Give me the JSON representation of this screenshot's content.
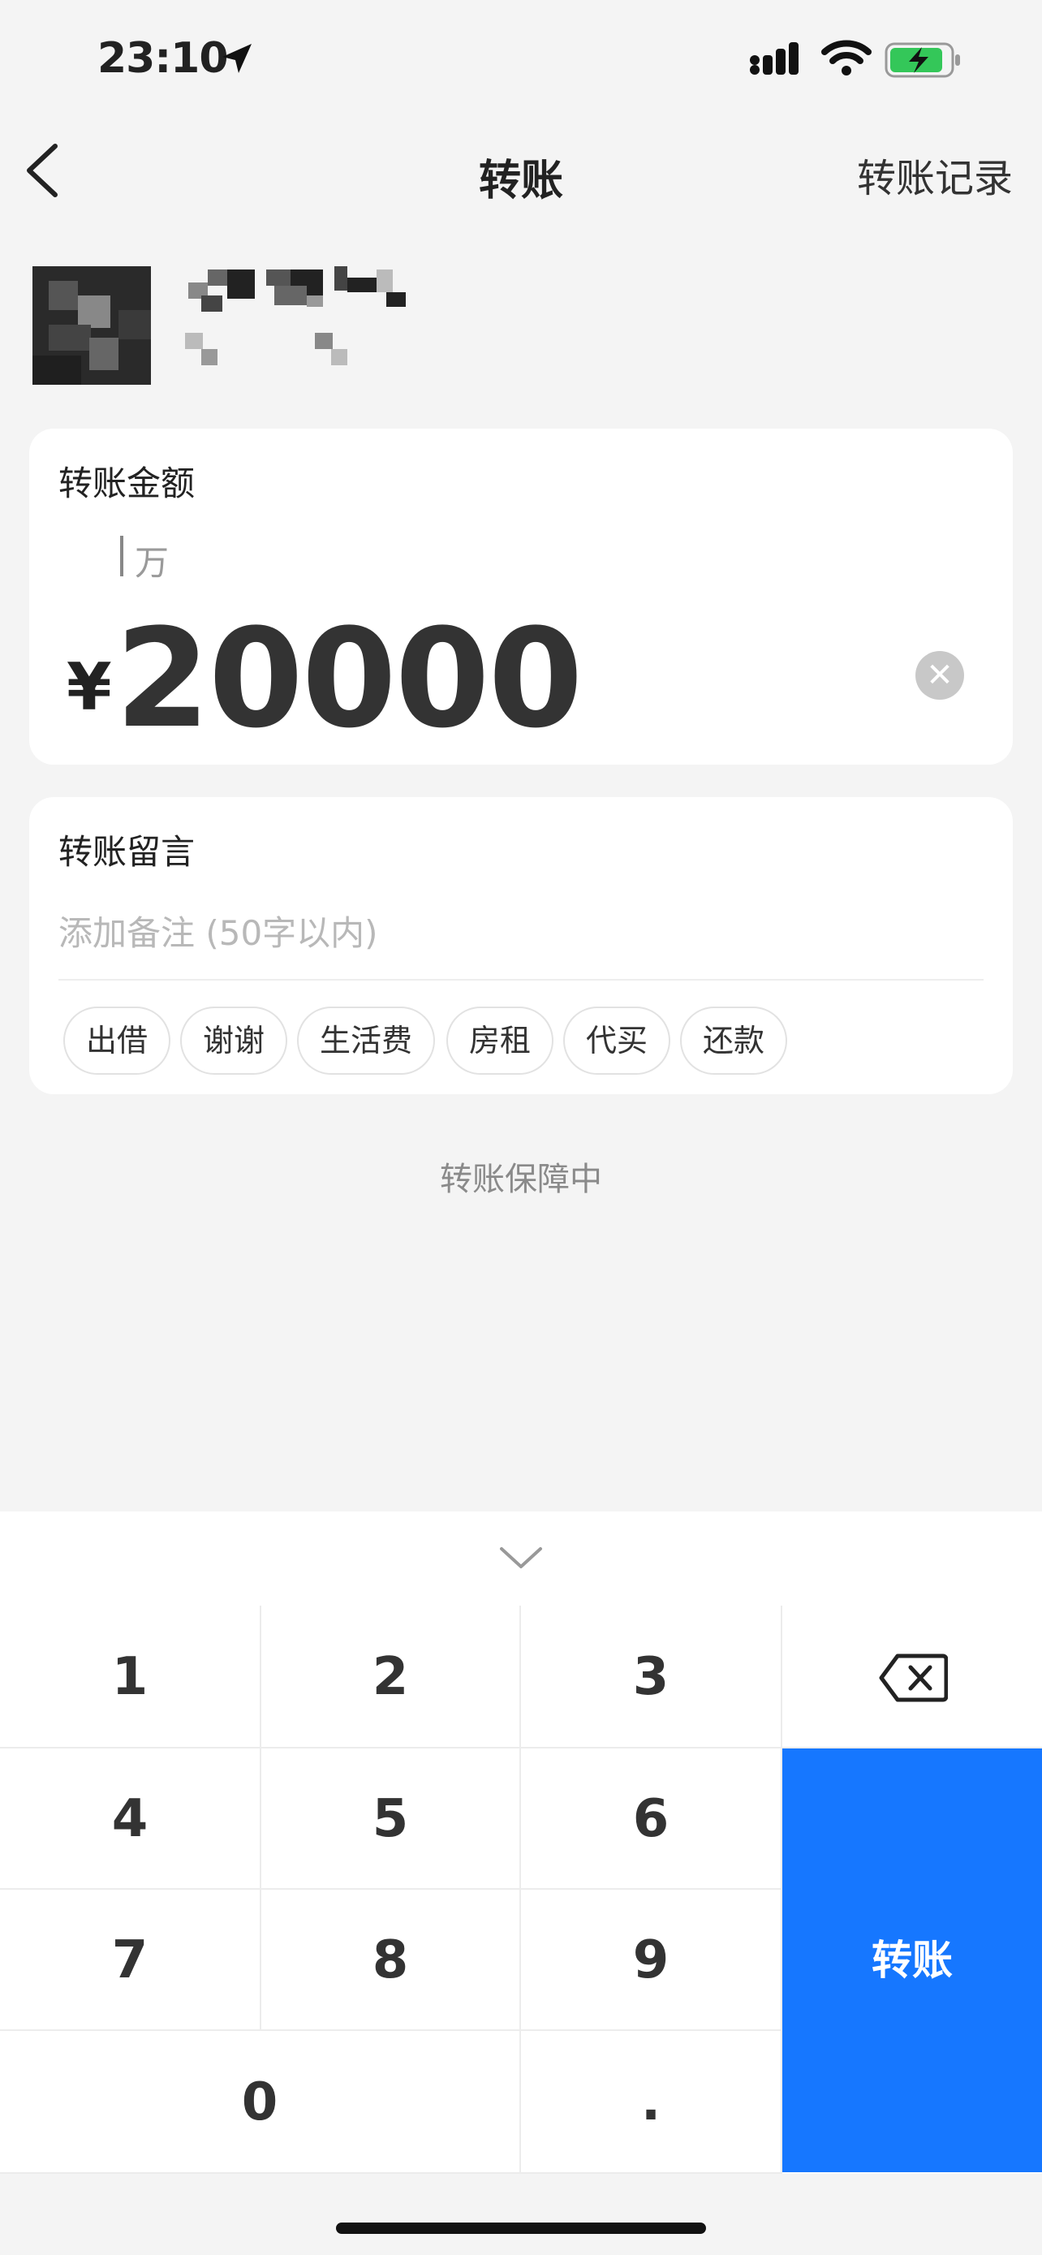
{
  "status_bar": {
    "time": "23:10"
  },
  "nav": {
    "title": "转账",
    "record_link": "转账记录"
  },
  "amount_card": {
    "label": "转账金额",
    "unit_hint": "万",
    "currency_symbol": "¥",
    "amount": "20000"
  },
  "remark_card": {
    "label": "转账留言",
    "placeholder": "添加备注 (50字以内)",
    "chips": [
      "出借",
      "谢谢",
      "生活费",
      "房租",
      "代买",
      "还款"
    ]
  },
  "guarantee_text": "转账保障中",
  "keypad": {
    "keys": [
      "1",
      "2",
      "3",
      "4",
      "5",
      "6",
      "7",
      "8",
      "9",
      "0",
      "."
    ],
    "transfer_label": "转账"
  },
  "colors": {
    "accent": "#1677ff",
    "background": "#f4f4f4",
    "battery_charging": "#34c759"
  }
}
